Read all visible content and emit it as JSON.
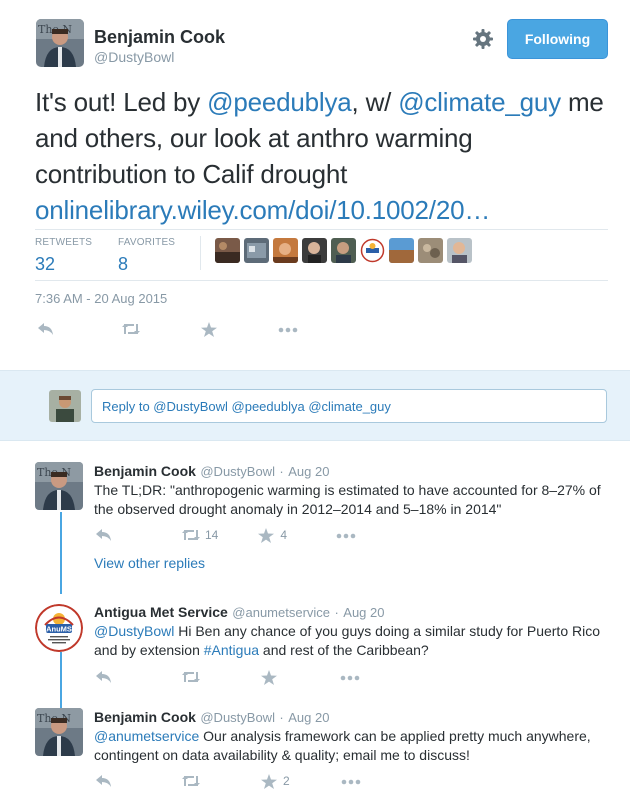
{
  "author": {
    "name": "Benjamin Cook",
    "handle": "@DustyBowl"
  },
  "follow_button": "Following",
  "tweet": {
    "text_parts": [
      "It's out! Led by ",
      "@peedublya",
      ", w/ ",
      "@climate_guy",
      " me and others, our look at anthro warming contribution to Calif drought ",
      "onlinelibrary.wiley.com/doi/10.1002/20…"
    ],
    "retweets_label": "RETWEETS",
    "retweets": "32",
    "favorites_label": "FAVORITES",
    "favorites": "8",
    "timestamp": "7:36 AM - 20 Aug 2015"
  },
  "reply_box": {
    "placeholder": "Reply to @DustyBowl @peedublya @climate_guy"
  },
  "replies": [
    {
      "name": "Benjamin Cook",
      "handle": "@DustyBowl",
      "sep": "·",
      "date": "Aug 20",
      "text": "The TL;DR: \"anthropogenic warming is estimated to have accounted for 8–27% of the observed drought anomaly in 2012–2014 and 5–18% in 2014\"",
      "retweets": "14",
      "favorites": "4"
    },
    {
      "name": "Antigua Met Service",
      "handle": "@anumetservice",
      "sep": "·",
      "date": "Aug 20",
      "text_parts": [
        "@DustyBowl",
        " Hi Ben any chance of you guys doing a similar study for Puerto Rico and by extension ",
        "#Antigua",
        "  and rest of the Caribbean?"
      ],
      "logo_text": "AnuMS",
      "logo_sub": "Antigua Meteorological Service"
    },
    {
      "name": "Benjamin Cook",
      "handle": "@DustyBowl",
      "sep": "·",
      "date": "Aug 20",
      "text_parts": [
        "@anumetservice",
        " Our analysis framework can be applied pretty much anywhere, contingent on data availability & quality; email me to discuss!"
      ],
      "favorites": "2"
    }
  ],
  "view_other_replies": "View other replies",
  "colors": {
    "link": "#2b7bb9",
    "follow_bg": "#4aa6e2",
    "thread_line": "#4aa6e2",
    "muted": "#8899a6"
  }
}
